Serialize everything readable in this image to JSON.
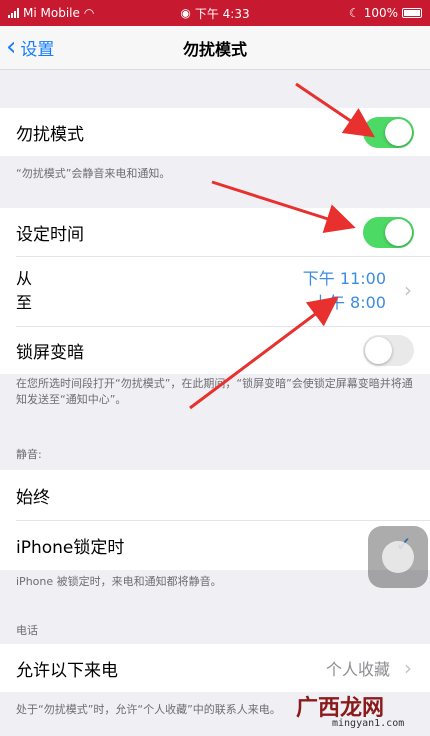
{
  "status_bar": {
    "carrier": "Mi Mobile",
    "time": "下午 4:33",
    "battery": "100%"
  },
  "nav": {
    "back_label": "设置",
    "title": "勿扰模式"
  },
  "dnd": {
    "label": "勿扰模式",
    "enabled": true,
    "note": "“勿扰模式”会静音来电和通知。"
  },
  "schedule": {
    "label": "设定时间",
    "enabled": true,
    "from_label": "从",
    "to_label": "至",
    "from_time": "下午 11:00",
    "to_time": "上午 8:00"
  },
  "dim_lock": {
    "label": "锁屏变暗",
    "enabled": false,
    "note": "在您所选时间段打开“勿扰模式”，在此期间，“锁屏变暗”会使锁定屏幕变暗并将通知发送至“通知中心”。"
  },
  "silence": {
    "header": "静音:",
    "always_label": "始终",
    "locked_label": "iPhone锁定时",
    "note": "iPhone 被锁定时，来电和通知都将静音。"
  },
  "phone": {
    "header": "电话",
    "allow_calls_label": "允许以下来电",
    "allow_calls_value": "个人收藏",
    "note": "处于“勿扰模式”时，允许“个人收藏”中的联系人来电。"
  },
  "watermark": {
    "title": "广西龙网",
    "url": "mingyan1.com"
  },
  "colors": {
    "status_bar": "#c7192f",
    "accent_blue": "#147efb",
    "switch_on": "#4cd964",
    "arrow_red": "#e8302e"
  }
}
